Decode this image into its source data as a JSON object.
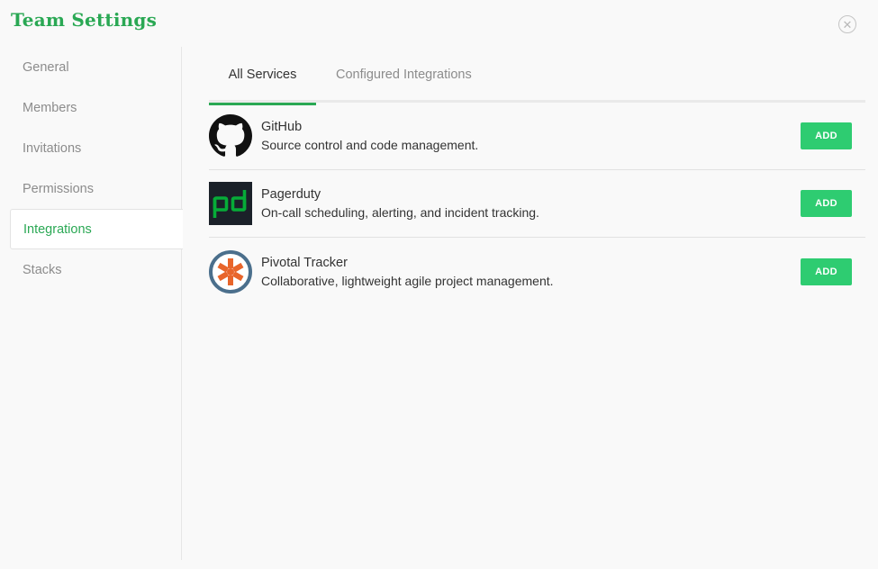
{
  "header": {
    "title": "Team Settings",
    "close_icon": "close-icon"
  },
  "sidebar": {
    "items": [
      {
        "label": "General"
      },
      {
        "label": "Members"
      },
      {
        "label": "Invitations"
      },
      {
        "label": "Permissions"
      },
      {
        "label": "Integrations",
        "active": true
      },
      {
        "label": "Stacks"
      }
    ]
  },
  "tabs": [
    {
      "label": "All Services",
      "active": true
    },
    {
      "label": "Configured Integrations"
    }
  ],
  "services": [
    {
      "name": "GitHub",
      "description": "Source control and code management.",
      "button": "ADD",
      "icon": "github-icon"
    },
    {
      "name": "Pagerduty",
      "description": "On-call scheduling, alerting, and incident tracking.",
      "button": "ADD",
      "icon": "pagerduty-icon"
    },
    {
      "name": "Pivotal Tracker",
      "description": "Collaborative, lightweight agile project management.",
      "button": "ADD",
      "icon": "pivotal-tracker-icon"
    }
  ],
  "colors": {
    "accent_green": "#2aa854",
    "button_green": "#2ecc71",
    "pagerduty_green": "#06ac38",
    "pivotal_orange": "#e8652b",
    "pivotal_blue": "#4b6f8c"
  }
}
